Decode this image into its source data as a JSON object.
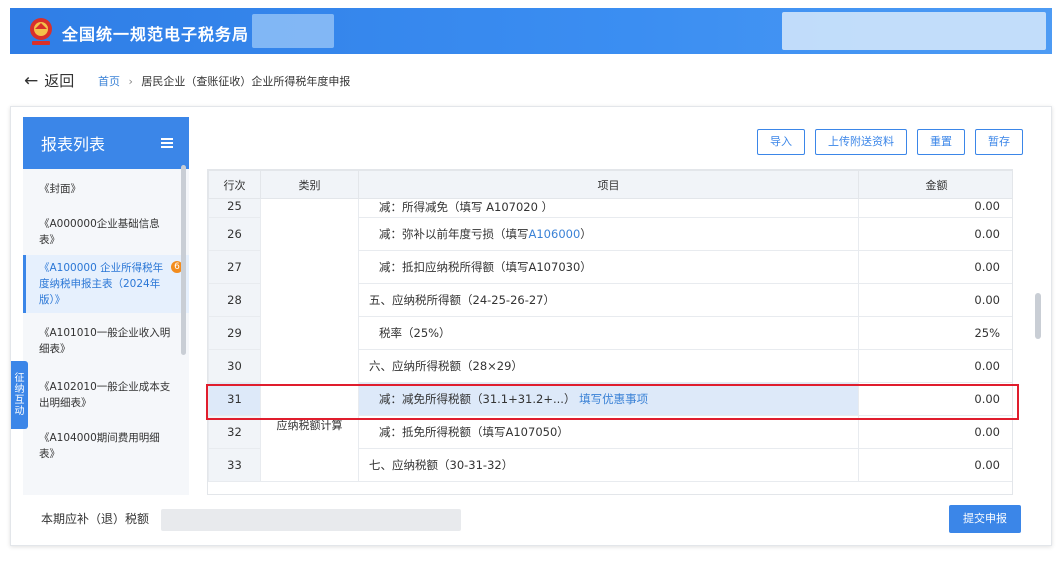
{
  "header": {
    "title": "全国统一规范电子税务局"
  },
  "nav": {
    "back_label": "返回",
    "breadcrumb": {
      "home": "首页",
      "current": "居民企业（查账征收）企业所得税年度申报"
    }
  },
  "sidebar": {
    "title": "报表列表",
    "items": [
      {
        "label": "《封面》"
      },
      {
        "label": "《A000000企业基础信息表》"
      },
      {
        "label": "《A100000 企业所得税年度纳税申报主表（2024年版）》",
        "badge": "6",
        "active": true
      },
      {
        "label": "《A101010一般企业收入明细表》"
      },
      {
        "label": "《A102010一般企业成本支出明细表》"
      },
      {
        "label": "《A104000期间费用明细表》"
      }
    ],
    "float_tab": [
      "征",
      "纳",
      "互",
      "动"
    ]
  },
  "toolbar": {
    "import": "导入",
    "upload": "上传附送资料",
    "reset": "重置",
    "save": "暂存"
  },
  "table": {
    "headers": {
      "row": "行次",
      "category": "类别",
      "item": "项目",
      "amount": "金额"
    },
    "category_label": "应纳税额计算",
    "rows": [
      {
        "no": "25",
        "item": "减：所得减免（填写 A107020 ）",
        "amount": "0.00"
      },
      {
        "no": "26",
        "item": "减：弥补以前年度亏损（填写",
        "link": "A106000",
        "item_end": "）",
        "amount": "0.00"
      },
      {
        "no": "27",
        "item": "减：抵扣应纳税所得额（填写A107030）",
        "amount": "0.00"
      },
      {
        "no": "28",
        "item": "五、应纳税所得额（24-25-26-27）",
        "amount": "0.00"
      },
      {
        "no": "29",
        "item": "税率（25%）",
        "amount": "25%"
      },
      {
        "no": "30",
        "item": "六、应纳所得税额（28×29）",
        "amount": "0.00"
      },
      {
        "no": "31",
        "item": "减：减免所得税额（31.1+31.2+...）",
        "link": "填写优惠事项",
        "amount": "0.00"
      },
      {
        "no": "32",
        "item": "减：抵免所得税额（填写A107050）",
        "amount": "0.00"
      },
      {
        "no": "33",
        "item": "七、应纳税额（30-31-32）",
        "amount": "0.00"
      }
    ]
  },
  "footer": {
    "label": "本期应补（退）税额",
    "submit": "提交申报"
  },
  "colors": {
    "primary": "#3b86e8",
    "highlight": "#e01d2d",
    "badge": "#f28c1e"
  }
}
